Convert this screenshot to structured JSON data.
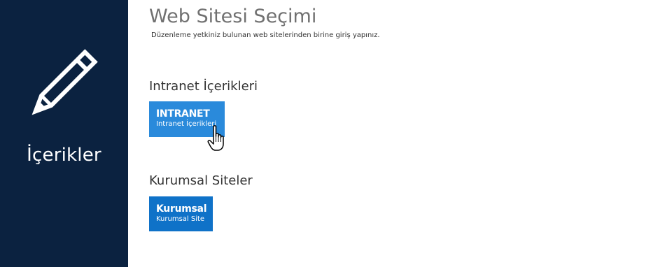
{
  "sidebar": {
    "icon": "pencil-icon",
    "label": "İçerikler",
    "background_color": "#0b2240"
  },
  "header": {
    "title": "Web Sitesi Seçimi",
    "subtitle": "Düzenleme yetkiniz bulunan web sitelerinden birine giriş yapınız."
  },
  "groups": [
    {
      "heading": "Intranet İçerikleri",
      "tiles": [
        {
          "title": "INTRANET",
          "subtitle": "Intranet İçerikleri",
          "color": "#2a8adb"
        }
      ]
    },
    {
      "heading": "Kurumsal Siteler",
      "tiles": [
        {
          "title": "Kurumsal",
          "subtitle": "Kurumsal Site",
          "color": "#0f72c8"
        }
      ]
    }
  ],
  "cursor": {
    "icon": "hand-pointer-icon"
  }
}
